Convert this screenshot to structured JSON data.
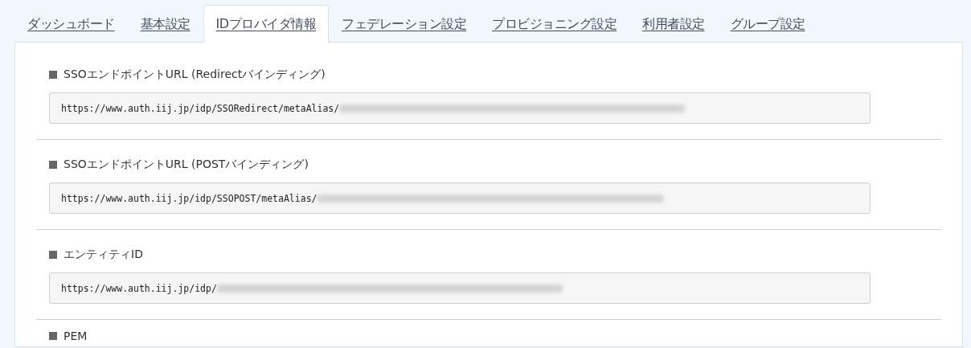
{
  "tabs": [
    {
      "label": "ダッシュボード",
      "selected": false
    },
    {
      "label": "基本設定",
      "selected": false
    },
    {
      "label": "IDプロバイダ情報",
      "selected": true
    },
    {
      "label": "フェデレーション設定",
      "selected": false
    },
    {
      "label": "プロビジョニング設定",
      "selected": false
    },
    {
      "label": "利用者設定",
      "selected": false
    },
    {
      "label": "グループ設定",
      "selected": false
    }
  ],
  "sections": [
    {
      "label": "SSOエンドポイントURL (Redirectバインディング)",
      "value": "https://www.auth.iij.jp/idp/SSORedirect/metaAlias/"
    },
    {
      "label": "SSOエンドポイントURL (POSTバインディング)",
      "value": "https://www.auth.iij.jp/idp/SSOPOST/metaAlias/"
    },
    {
      "label": "エンティティID",
      "value": "https://www.auth.iij.jp/idp/"
    },
    {
      "label": "PEM"
    }
  ]
}
